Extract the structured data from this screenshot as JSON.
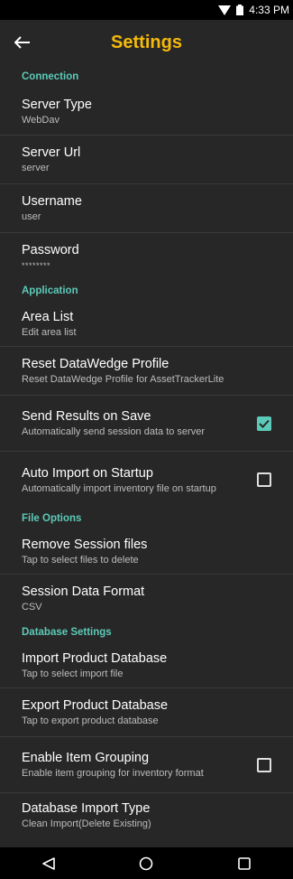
{
  "status_bar": {
    "time": "4:33 PM",
    "wifi_icon": "wifi-icon",
    "battery_icon": "battery-icon"
  },
  "app_bar": {
    "title": "Settings",
    "back_icon": "back-arrow-icon"
  },
  "sections": {
    "connection": "Connection",
    "application": "Application",
    "file_options": "File Options",
    "database": "Database Settings"
  },
  "prefs": {
    "server_type": {
      "title": "Server Type",
      "summary": "WebDav"
    },
    "server_url": {
      "title": "Server Url",
      "summary": "server"
    },
    "username": {
      "title": "Username",
      "summary": "user"
    },
    "password": {
      "title": "Password",
      "summary": "********"
    },
    "area_list": {
      "title": "Area List",
      "summary": "Edit area list"
    },
    "reset_datawedge": {
      "title": "Reset DataWedge Profile",
      "summary": "Reset DataWedge Profile for AssetTrackerLite"
    },
    "send_results": {
      "title": "Send Results on Save",
      "summary": "Automatically send session data to server",
      "checked": true
    },
    "auto_import": {
      "title": "Auto Import on Startup",
      "summary": "Automatically import inventory file on startup",
      "checked": false
    },
    "remove_session": {
      "title": "Remove Session files",
      "summary": "Tap to select files to delete"
    },
    "session_format": {
      "title": "Session Data Format",
      "summary": "CSV"
    },
    "import_db": {
      "title": "Import Product Database",
      "summary": "Tap to select import file"
    },
    "export_db": {
      "title": "Export Product Database",
      "summary": "Tap to export product database"
    },
    "item_grouping": {
      "title": "Enable Item Grouping",
      "summary": "Enable item grouping for inventory format",
      "checked": false
    },
    "db_import_type": {
      "title": "Database Import Type",
      "summary": "Clean Import(Delete Existing)"
    }
  },
  "nav_bar": {
    "back_icon": "nav-back-icon",
    "home_icon": "nav-home-icon",
    "recents_icon": "nav-recents-icon"
  },
  "colors": {
    "accent": "#f5b90a",
    "section": "#5ccab8",
    "background": "#272727"
  }
}
